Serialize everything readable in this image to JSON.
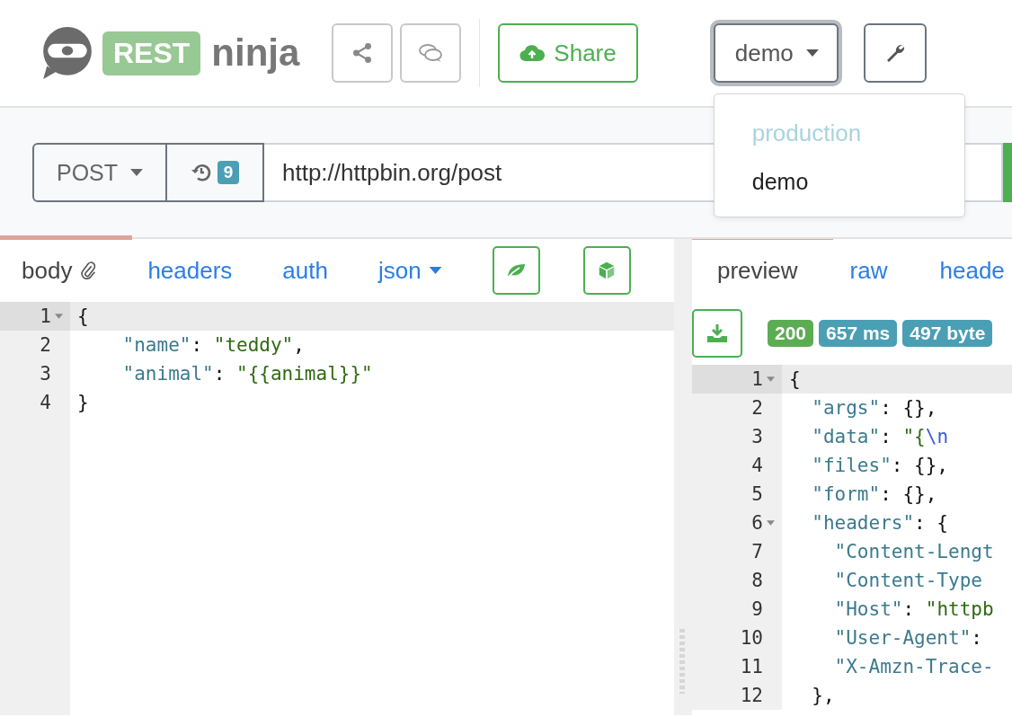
{
  "header": {
    "logo_badge": "REST",
    "logo_text": "ninja",
    "share_button": "Share",
    "environment": {
      "value": "demo",
      "open": true,
      "options": [
        {
          "label": "production",
          "kind": "header"
        },
        {
          "label": "demo",
          "kind": "item"
        }
      ]
    }
  },
  "request": {
    "method": "POST",
    "history_count": "9",
    "url": "http://httpbin.org/post"
  },
  "request_tabs": [
    {
      "label": "body",
      "kind": "attach",
      "selected": true
    },
    {
      "label": "headers",
      "kind": "plain",
      "selected": false
    },
    {
      "label": "auth",
      "kind": "plain",
      "selected": false
    },
    {
      "label": "json",
      "kind": "dropdown",
      "selected": false
    }
  ],
  "request_body": [
    {
      "number": "1",
      "foldable": true,
      "active": true,
      "tokens": [
        {
          "kind": "punc",
          "text": "{"
        }
      ]
    },
    {
      "number": "2",
      "foldable": false,
      "active": false,
      "tokens": [
        {
          "kind": "key",
          "text": "    \"name\""
        },
        {
          "kind": "punc",
          "text": ": "
        },
        {
          "kind": "str",
          "text": "\"teddy\""
        },
        {
          "kind": "punc",
          "text": ","
        }
      ]
    },
    {
      "number": "3",
      "foldable": false,
      "active": false,
      "tokens": [
        {
          "kind": "key",
          "text": "    \"animal\""
        },
        {
          "kind": "punc",
          "text": ": "
        },
        {
          "kind": "str",
          "text": "\"{{animal}}\""
        }
      ]
    },
    {
      "number": "4",
      "foldable": false,
      "active": false,
      "tokens": [
        {
          "kind": "punc",
          "text": "}"
        }
      ]
    }
  ],
  "response_tabs": [
    {
      "label": "preview",
      "selected": true
    },
    {
      "label": "raw",
      "selected": false
    },
    {
      "label": "heade",
      "selected": false
    }
  ],
  "response_badges": [
    {
      "text": "200",
      "kind": "status"
    },
    {
      "text": "657 ms",
      "kind": "info"
    },
    {
      "text": "497 byte",
      "kind": "info"
    }
  ],
  "response_body": [
    {
      "number": "1",
      "foldable": true,
      "active": true,
      "tokens": [
        {
          "kind": "punc",
          "text": "{"
        }
      ]
    },
    {
      "number": "2",
      "foldable": false,
      "active": false,
      "tokens": [
        {
          "kind": "key",
          "text": "  \"args\""
        },
        {
          "kind": "punc",
          "text": ": {},"
        }
      ]
    },
    {
      "number": "3",
      "foldable": false,
      "active": false,
      "tokens": [
        {
          "kind": "key",
          "text": "  \"data\""
        },
        {
          "kind": "punc",
          "text": ": "
        },
        {
          "kind": "str",
          "text": "\"{"
        },
        {
          "kind": "esc",
          "text": "\\n"
        }
      ]
    },
    {
      "number": "4",
      "foldable": false,
      "active": false,
      "tokens": [
        {
          "kind": "key",
          "text": "  \"files\""
        },
        {
          "kind": "punc",
          "text": ": {},"
        }
      ]
    },
    {
      "number": "5",
      "foldable": false,
      "active": false,
      "tokens": [
        {
          "kind": "key",
          "text": "  \"form\""
        },
        {
          "kind": "punc",
          "text": ": {},"
        }
      ]
    },
    {
      "number": "6",
      "foldable": true,
      "active": false,
      "tokens": [
        {
          "kind": "key",
          "text": "  \"headers\""
        },
        {
          "kind": "punc",
          "text": ": {"
        }
      ]
    },
    {
      "number": "7",
      "foldable": false,
      "active": false,
      "tokens": [
        {
          "kind": "key",
          "text": "    \"Content-Lengt"
        }
      ]
    },
    {
      "number": "8",
      "foldable": false,
      "active": false,
      "tokens": [
        {
          "kind": "key",
          "text": "    \"Content-Type"
        }
      ]
    },
    {
      "number": "9",
      "foldable": false,
      "active": false,
      "tokens": [
        {
          "kind": "key",
          "text": "    \"Host\""
        },
        {
          "kind": "punc",
          "text": ": "
        },
        {
          "kind": "str",
          "text": "\"httpb"
        }
      ]
    },
    {
      "number": "10",
      "foldable": false,
      "active": false,
      "tokens": [
        {
          "kind": "key",
          "text": "    \"User-Agent\""
        },
        {
          "kind": "punc",
          "text": ":"
        }
      ]
    },
    {
      "number": "11",
      "foldable": false,
      "active": false,
      "tokens": [
        {
          "kind": "key",
          "text": "    \"X-Amzn-Trace-"
        }
      ]
    },
    {
      "number": "12",
      "foldable": false,
      "active": false,
      "tokens": [
        {
          "kind": "punc",
          "text": "  },"
        }
      ]
    }
  ]
}
